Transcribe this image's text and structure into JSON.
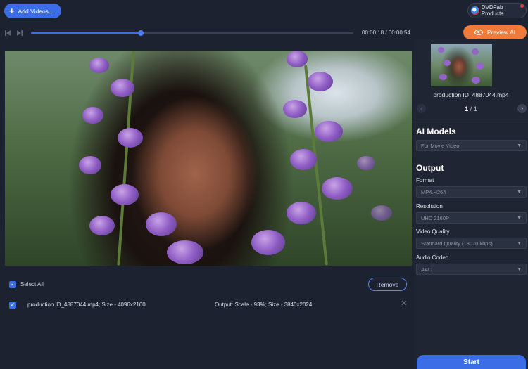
{
  "toolbar": {
    "add_videos_label": "Add Videos...",
    "products_label": "DVDFab Products"
  },
  "player": {
    "progress_fraction": 0.34,
    "timecode": "00:00:18 / 00:00:54"
  },
  "preview_ai": {
    "label": "Preview AI"
  },
  "thumbnail_panel": {
    "file_name": "production ID_4887044.mp4",
    "page_current": "1",
    "page_total": "/ 1"
  },
  "ai_models": {
    "title": "AI Models",
    "selected": "For Movie Video"
  },
  "output": {
    "title": "Output",
    "format_label": "Format",
    "format_value": "MP4.H264",
    "resolution_label": "Resolution",
    "resolution_value": "UHD 2160P",
    "video_quality_label": "Video Quality",
    "video_quality_value": "Standard Quality (18070 kbps)",
    "audio_codec_label": "Audio Codec",
    "audio_codec_value": "AAC"
  },
  "file_list": {
    "select_all_label": "Select All",
    "remove_label": "Remove",
    "items": [
      {
        "name": "production ID_4887044.mp4; Size - 4096x2160",
        "output": "Output: Scale - 93%; Size - 3840x2024"
      }
    ]
  },
  "start_label": "Start",
  "colors": {
    "accent_blue": "#3b6ee6",
    "preview_orange": "#f07a3a",
    "background": "#1c2230",
    "panel": "#1f2533"
  }
}
